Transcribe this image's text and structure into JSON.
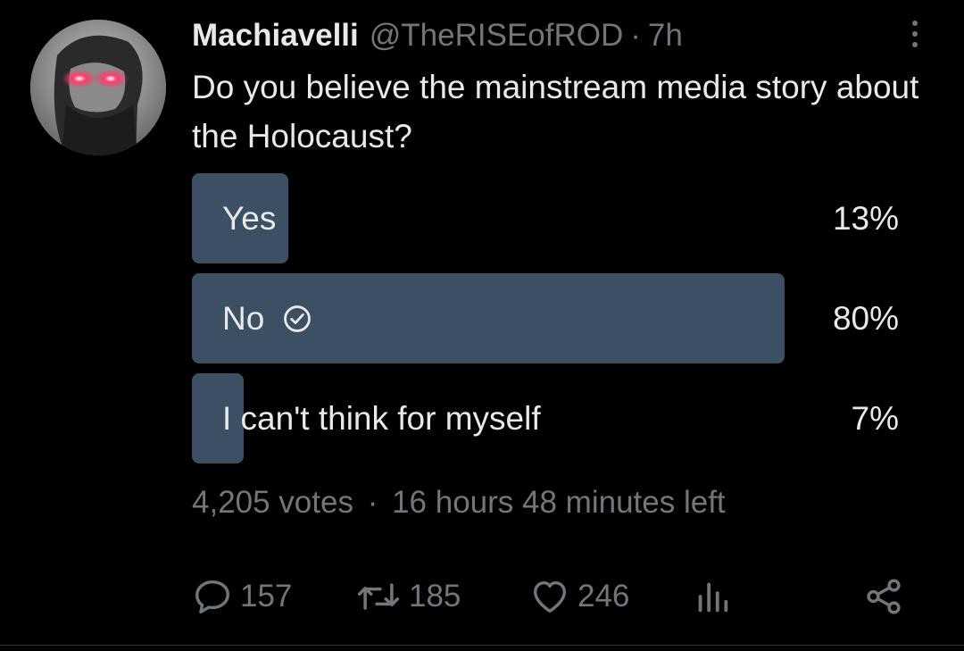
{
  "tweet": {
    "author_name": "Machiavelli",
    "author_handle": "@TheRISEofROD",
    "separator": "·",
    "time": "7h",
    "text": "Do you believe the mainstream media story about the Holocaust?"
  },
  "poll": {
    "options": [
      {
        "label": "Yes",
        "percent": "13%",
        "fill": 13,
        "selected": false
      },
      {
        "label": "No",
        "percent": "80%",
        "fill": 80,
        "selected": true
      },
      {
        "label": "I can't think for myself",
        "percent": "7%",
        "fill": 7,
        "selected": false
      }
    ],
    "votes": "4,205 votes",
    "dot": "·",
    "time_left": "16 hours 48 minutes left"
  },
  "actions": {
    "replies": "157",
    "reposts": "185",
    "likes": "246"
  },
  "icons": {
    "more": "more-vertical-icon",
    "check": "check-circle-icon",
    "reply": "reply-icon",
    "repost": "repost-icon",
    "like": "heart-icon",
    "views": "analytics-icon",
    "share": "share-icon"
  },
  "colors": {
    "background": "#000000",
    "text": "#e7e9ea",
    "muted": "#71767b",
    "poll_bar": "#3c4f63"
  }
}
